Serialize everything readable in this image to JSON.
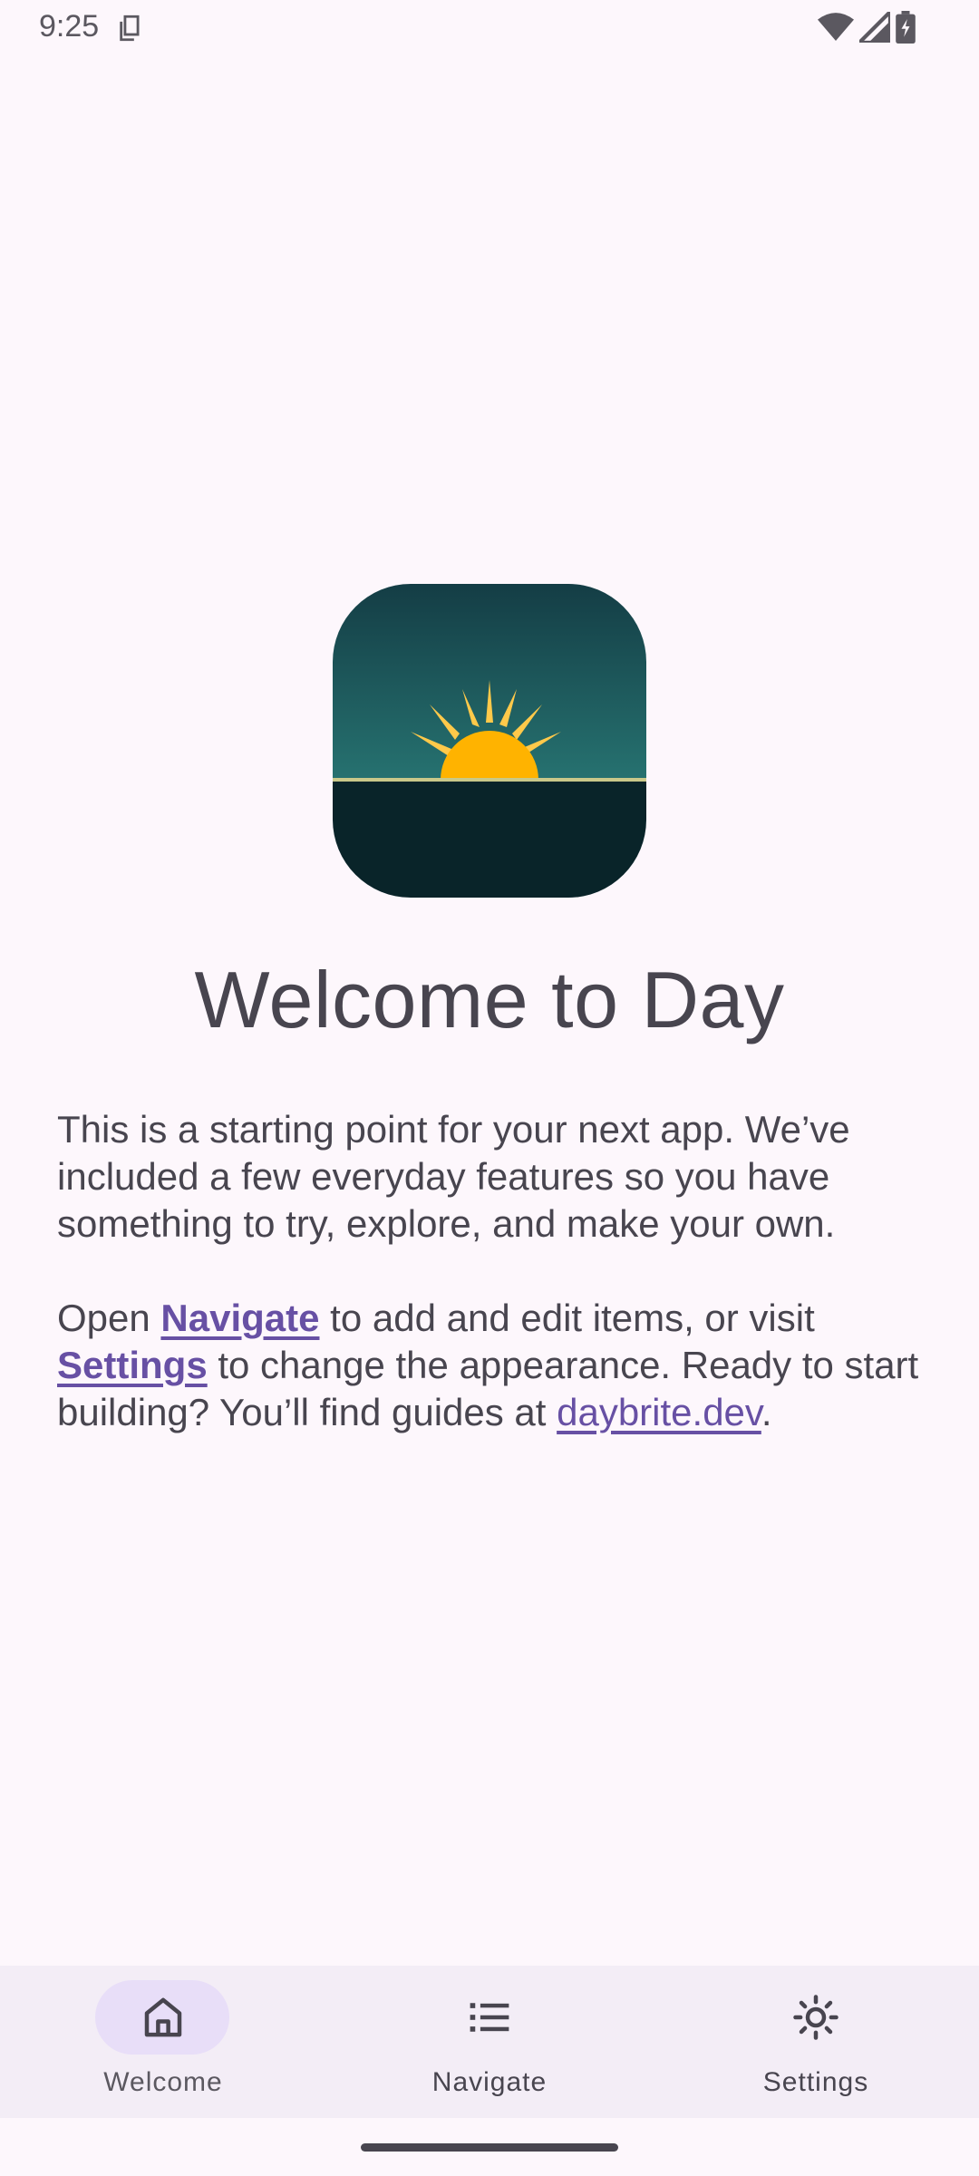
{
  "status_bar": {
    "time": "9:25",
    "icons": [
      "sim-card-icon",
      "wifi-icon",
      "signal-icon",
      "battery-icon"
    ]
  },
  "app": {
    "logo_icon": "sunrise-logo-icon",
    "title": "Welcome to Day"
  },
  "intro": {
    "paragraph_1": "This is a starting point for your next app. We’ve included a few everyday features so you have something to try, explore, and make your own.",
    "p2_part_1": "Open ",
    "p2_link_navigate": "Navigate",
    "p2_part_2": " to add and edit items, or visit ",
    "p2_link_settings": "Settings",
    "p2_part_3": " to change the appearance. Ready to start building? You’ll find guides at ",
    "p2_link_site": "daybrite.dev",
    "p2_part_4": "."
  },
  "bottom_nav": {
    "items": [
      {
        "label": "Welcome",
        "icon": "home-icon",
        "active": true
      },
      {
        "label": "Navigate",
        "icon": "list-icon",
        "active": false
      },
      {
        "label": "Settings",
        "icon": "sun-icon",
        "active": false
      }
    ]
  },
  "colors": {
    "background": "#fdf7fc",
    "text": "#48454f",
    "link": "#6750a4",
    "nav_background": "#f3edf6",
    "active_pill": "#e8def8",
    "logo_sky_top": "#143d45",
    "logo_sky_bottom": "#226a6c",
    "logo_ground": "#092429",
    "sun": "#ffb300"
  }
}
